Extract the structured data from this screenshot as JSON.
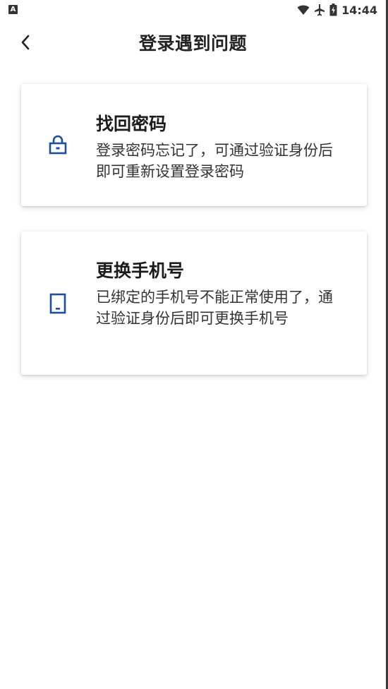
{
  "status_bar": {
    "left_icon": "A",
    "icons": [
      "wifi-icon",
      "airplane-icon",
      "battery-icon"
    ],
    "time": "14:44"
  },
  "header": {
    "back_icon": "chevron-left-icon",
    "title": "登录遇到问题"
  },
  "options": [
    {
      "icon": "lock-icon",
      "title": "找回密码",
      "description": "登录密码忘记了，可通过验证身份后即可重新设置登录密码"
    },
    {
      "icon": "phone-icon",
      "title": "更换手机号",
      "description": "已绑定的手机号不能正常使用了，通过验证身份后即可更换手机号"
    }
  ],
  "colors": {
    "accent": "#1f4e9c",
    "background": "#ffffff",
    "title_text": "#1c1c1c",
    "body_text": "#333333"
  }
}
